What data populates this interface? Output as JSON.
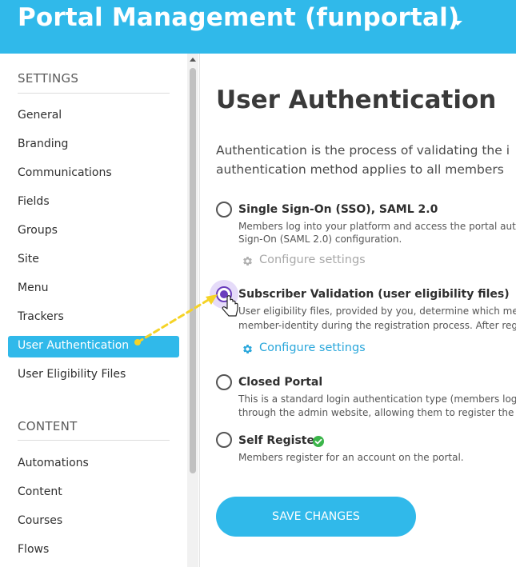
{
  "header": {
    "title": "Portal Management (funportal)",
    "icon": "chevron-down-icon",
    "background_color": "#30b9ea"
  },
  "sidebar": {
    "settings_title": "SETTINGS",
    "settings_items": [
      {
        "label": "General"
      },
      {
        "label": "Branding"
      },
      {
        "label": "Communications"
      },
      {
        "label": "Fields"
      },
      {
        "label": "Groups"
      },
      {
        "label": "Site"
      },
      {
        "label": "Menu"
      },
      {
        "label": "Trackers"
      },
      {
        "label": "User Authentication",
        "active": true
      },
      {
        "label": "User Eligibility Files"
      }
    ],
    "content_title": "CONTENT",
    "content_items": [
      {
        "label": "Automations"
      },
      {
        "label": "Content"
      },
      {
        "label": "Courses"
      },
      {
        "label": "Flows"
      }
    ]
  },
  "main": {
    "title": "User Authentication",
    "intro_line1": "Authentication is the process of validating the i",
    "intro_line2": "authentication method applies to all members",
    "options": [
      {
        "label": "Single Sign-On (SSO), SAML 2.0",
        "desc1": "Members log into your platform and access the portal auto",
        "desc2": "Sign-On (SAML 2.0) configuration.",
        "configure_label": "Configure settings",
        "configure_enabled": false,
        "selected": false
      },
      {
        "label": "Subscriber Validation (user eligibility files)",
        "desc1": "User eligibility files, provided by you, determine which me",
        "desc2": "member-identity during the registration process. After reg",
        "configure_label": "Configure settings",
        "configure_enabled": true,
        "selected": true
      },
      {
        "label": "Closed Portal",
        "desc1": "This is a standard login authentication type (members log",
        "desc2": "through the admin website, allowing them to register the",
        "selected": false
      },
      {
        "label": "Self Register",
        "desc1": "Members register for an account on the portal.",
        "badge_icon": "check-circle-icon",
        "selected": false
      }
    ],
    "save_label": "SAVE CHANGES"
  },
  "colors": {
    "accent": "#30b9ea",
    "radio_selected": "#6a3dbd",
    "check_green": "#3bb54a",
    "annotation_arrow": "#f5d327"
  }
}
